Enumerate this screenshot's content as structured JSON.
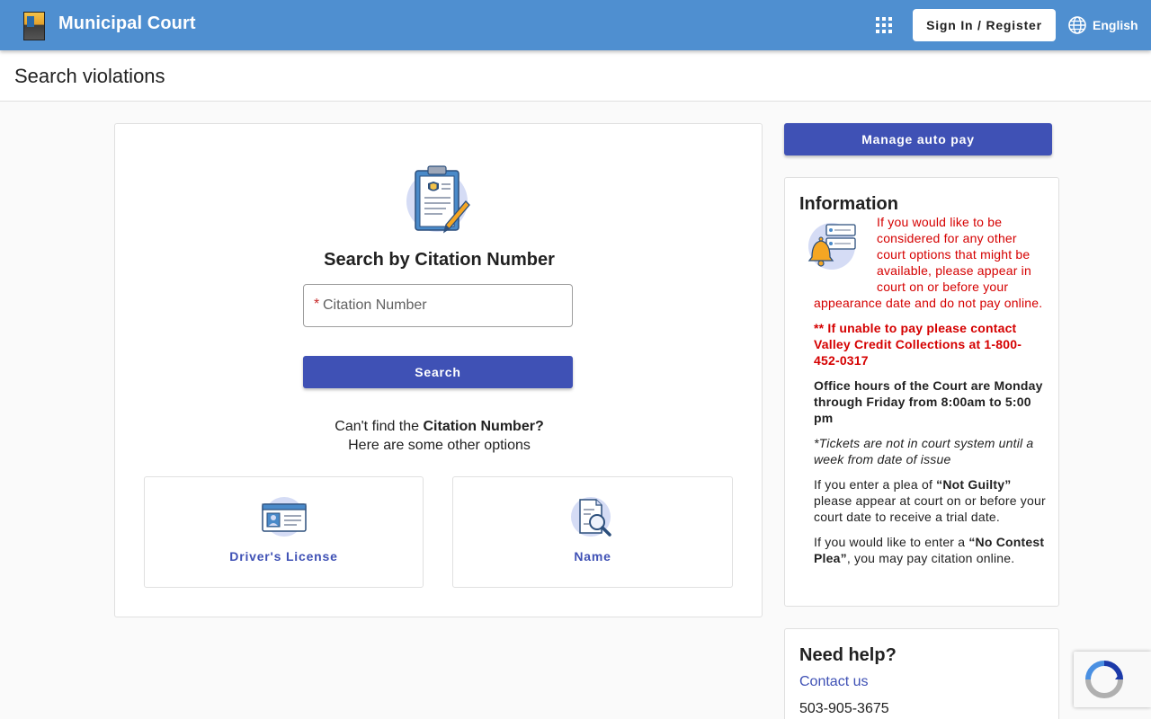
{
  "header": {
    "app_title": "Municipal Court",
    "signin_label": "Sign In / Register",
    "language_label": "English"
  },
  "page": {
    "title": "Search violations"
  },
  "search": {
    "heading": "Search by Citation Number",
    "required_mark": "*",
    "citation_placeholder": "Citation Number",
    "citation_value": "",
    "search_label": "Search",
    "cant_find_prefix": "Can't find the ",
    "cant_find_bold": "Citation Number?",
    "other_options": "Here are some other options",
    "options": [
      {
        "label": "Driver's License",
        "icon": "id-card-icon"
      },
      {
        "label": "Name",
        "icon": "document-search-icon"
      }
    ]
  },
  "sidebar": {
    "autopay_label": "Manage auto pay",
    "info_heading": "Information",
    "info_1": "If you would like to be considered for any other court options that might be available, please appear in court on or before your appearance date and do not pay online.",
    "info_2": "** If unable to pay please contact Valley Credit Collections at 1-800-452-0317",
    "info_3": "Office hours of the Court are Monday through Friday from 8:00am to 5:00 pm",
    "info_4": "*Tickets are not in court system until a week from date of issue",
    "info_5_a": "If you enter a plea of ",
    "info_5_b": "“Not Guilty”",
    "info_5_c": " please appear at court on or before your court date to receive a trial date.",
    "info_6_a": "If you would like to enter a ",
    "info_6_b": "“No Contest Plea”",
    "info_6_c": ", you may pay citation online.",
    "help_heading": "Need help?",
    "contact_label": "Contact us",
    "phone": "503-905-3675"
  },
  "colors": {
    "header_bg": "#4f8fd0",
    "primary": "#3f51b5",
    "alert_red": "#d50000"
  }
}
